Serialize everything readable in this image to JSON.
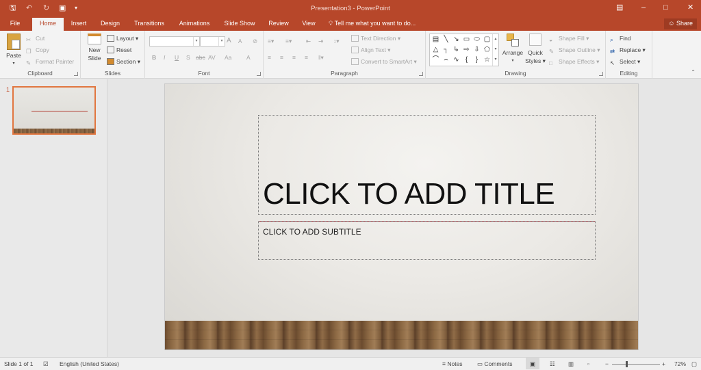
{
  "window": {
    "title": "Presentation3 - PowerPoint",
    "share": "Share"
  },
  "tabs": [
    "File",
    "Home",
    "Insert",
    "Design",
    "Transitions",
    "Animations",
    "Slide Show",
    "Review",
    "View"
  ],
  "active_tab": "Home",
  "tell_me": "Tell me what you want to do...",
  "ribbon": {
    "clipboard": {
      "paste": "Paste",
      "cut": "Cut",
      "copy": "Copy",
      "format_painter": "Format Painter",
      "label": "Clipboard"
    },
    "slides": {
      "new_slide_1": "New",
      "new_slide_2": "Slide",
      "layout": "Layout",
      "reset": "Reset",
      "section": "Section",
      "label": "Slides"
    },
    "font": {
      "label": "Font",
      "bold": "B",
      "italic": "I",
      "underline": "U",
      "shadow": "S",
      "strike": "abc",
      "spacing": "AV",
      "case": "Aa",
      "color": "A",
      "grow": "A",
      "shrink": "A"
    },
    "paragraph": {
      "text_direction": "Text Direction",
      "align_text": "Align Text",
      "smartart": "Convert to SmartArt",
      "label": "Paragraph"
    },
    "drawing": {
      "arrange": "Arrange",
      "quick_1": "Quick",
      "quick_2": "Styles",
      "shape_fill": "Shape Fill",
      "shape_outline": "Shape Outline",
      "shape_effects": "Shape Effects",
      "label": "Drawing"
    },
    "editing": {
      "find": "Find",
      "replace": "Replace",
      "select": "Select",
      "label": "Editing"
    }
  },
  "thumbnails": {
    "number": "1"
  },
  "slide": {
    "title": "CLICK TO ADD TITLE",
    "subtitle": "CLICK TO ADD SUBTITLE"
  },
  "status": {
    "slide_count": "Slide 1 of 1",
    "language": "English (United States)",
    "notes": "Notes",
    "comments": "Comments",
    "zoom": "72%"
  },
  "colors": {
    "accent": "#b7472a",
    "thumb_border": "#e1763f",
    "title_rule": "#a23540"
  },
  "icons": [
    "save-icon",
    "undo-icon",
    "redo-icon",
    "presentation-icon",
    "customize-icon",
    "lightbulb-icon",
    "user-icon",
    "paste-icon",
    "scissors-icon",
    "copy-icon",
    "brush-icon",
    "layout-icon",
    "reset-icon",
    "section-icon",
    "find-icon",
    "replace-icon",
    "select-icon",
    "notes-icon",
    "comments-icon",
    "normal-view-icon",
    "sorter-view-icon",
    "reading-view-icon",
    "slideshow-icon"
  ]
}
